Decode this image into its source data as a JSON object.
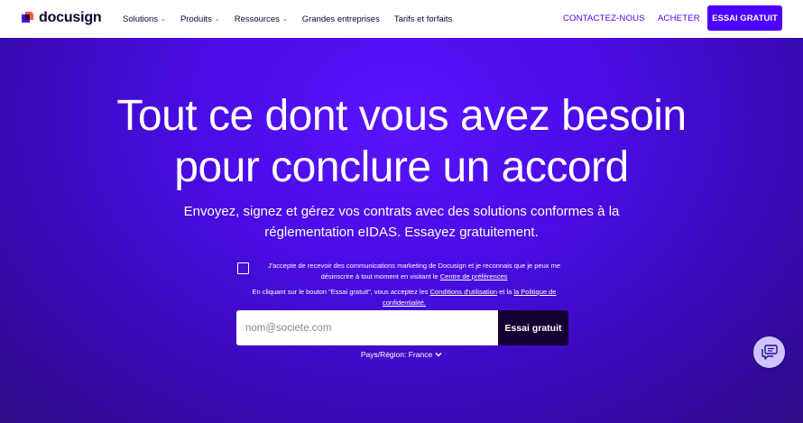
{
  "brand": {
    "name": "docusign",
    "accent": "#4c00ff",
    "dark": "#130032"
  },
  "nav": {
    "items": [
      {
        "label": "Solutions",
        "dropdown": true
      },
      {
        "label": "Produits",
        "dropdown": true
      },
      {
        "label": "Ressources",
        "dropdown": true
      },
      {
        "label": "Grandes entreprises",
        "dropdown": false
      },
      {
        "label": "Tarifs et forfaits",
        "dropdown": false
      }
    ],
    "contact_label": "CONTACTEZ-NOUS",
    "buy_label": "ACHETER",
    "trial_label": "ESSAI GRATUIT"
  },
  "hero": {
    "headline_line1": "Tout ce dont vous avez besoin",
    "headline_line2": "pour conclure un accord",
    "sub_line1": "Envoyez, signez et gérez vos contrats avec des solutions conformes à la",
    "sub_line2": "réglementation eIDAS. Essayez gratuitement.",
    "consent_text": "J'accepte de recevoir des communications marketing de Docusign et je reconnais que je peux me désinscrire à tout moment en visitant le ",
    "consent_link": "Centre de préférences",
    "terms_text": "En cliquant sur le bouton \"Essai gratuit\", vous acceptez les ",
    "terms_link1": "Conditions d'utilisation",
    "terms_mid": " et la ",
    "terms_link2": "la Politique de confidentialité.",
    "email_placeholder": "nom@societe.com",
    "submit_label": "Essai gratuit",
    "country_label": "Pays/Région: France",
    "consent_checked": false
  },
  "icons": {
    "chevron": "chevron-down-icon",
    "chat": "chat-icon"
  }
}
